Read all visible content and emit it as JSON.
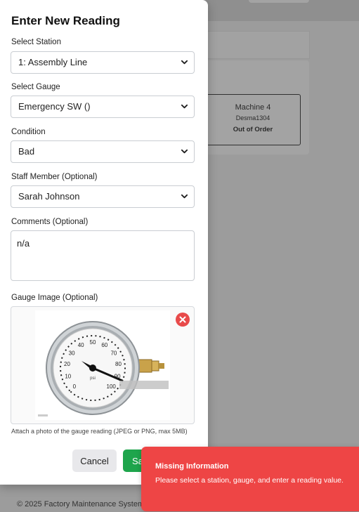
{
  "background": {
    "machine_card": {
      "name": "Machine 4",
      "code": "Desma1304",
      "status": "Out of Order"
    },
    "footer": "© 2025 Factory Maintenance System"
  },
  "modal": {
    "title": "Enter New Reading",
    "station": {
      "label": "Select Station",
      "value": "1: Assembly Line"
    },
    "gauge": {
      "label": "Select Gauge",
      "value": "Emergency SW ()"
    },
    "condition": {
      "label": "Condition",
      "value": "Bad"
    },
    "staff": {
      "label": "Staff Member (Optional)",
      "value": "Sarah Johnson"
    },
    "comments": {
      "label": "Comments (Optional)",
      "value": "n/a"
    },
    "image": {
      "label": "Gauge Image (Optional)",
      "helper": "Attach a photo of the gauge reading (JPEG or PNG, max 5MB)",
      "dial_unit": "psi",
      "dial_ticks": [
        "0",
        "10",
        "20",
        "30",
        "40",
        "50",
        "60",
        "70",
        "80",
        "90",
        "100"
      ]
    },
    "buttons": {
      "cancel": "Cancel",
      "save": "Sa"
    }
  },
  "toast": {
    "title": "Missing Information",
    "message": "Please select a station, gauge, and enter a reading value.",
    "color": "#ee4545"
  },
  "colors": {
    "save": "#1ea54c",
    "remove": "#e84a4a"
  },
  "icons": {
    "select_arrow": "chevron-down-icon",
    "remove": "close-circle-icon"
  }
}
